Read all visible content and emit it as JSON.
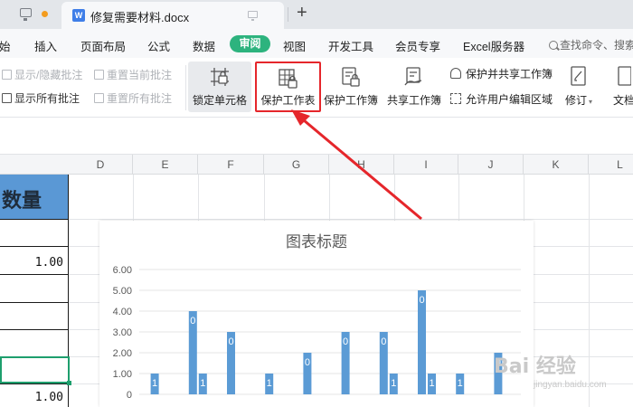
{
  "tabbar": {
    "doc_tab": {
      "icon_letter": "W",
      "title": "修复需要材料.docx"
    },
    "new_tab_glyph": "+"
  },
  "menu": {
    "items": [
      "始",
      "插入",
      "页面布局",
      "公式",
      "数据",
      "审阅",
      "视图",
      "开发工具",
      "会员专享",
      "Excel服务器"
    ],
    "active": "审阅",
    "search_text": "查找命令、搜索"
  },
  "ribbon": {
    "small_buttons": [
      {
        "label": "显示/隐藏批注",
        "enabled": false
      },
      {
        "label": "重置当前批注",
        "enabled": false
      },
      {
        "label": "显示所有批注",
        "enabled": true
      },
      {
        "label": "重置所有批注",
        "enabled": false
      }
    ],
    "big_buttons": [
      {
        "label": "锁定单元格",
        "state": "hover"
      },
      {
        "label": "保护工作表",
        "state": "highlighted"
      },
      {
        "label": "保护工作簿",
        "state": "normal"
      },
      {
        "label": "共享工作簿",
        "state": "normal"
      },
      {
        "label": "修订",
        "state": "normal"
      },
      {
        "label": "文档",
        "state": "normal"
      }
    ],
    "line_buttons": [
      {
        "label": "保护并共享工作簿"
      },
      {
        "label": "允许用户编辑区域"
      }
    ],
    "highlight_color": "#e5262b"
  },
  "sheet": {
    "columns": [
      "D",
      "E",
      "F",
      "G",
      "H",
      "I",
      "J",
      "K",
      "L"
    ],
    "cell_header": "数量",
    "cell_values": [
      {
        "row": 1,
        "value": "1.00"
      },
      {
        "row": 7,
        "value": "1.00"
      }
    ],
    "selection_color": "#1e9f6d",
    "header_fill": "#5a98d5"
  },
  "chart_data": {
    "type": "bar",
    "title": "图表标题",
    "xlabel": "",
    "ylabel": "",
    "ylim": [
      0,
      6
    ],
    "y_ticks": [
      "6.00",
      "5.00",
      "4.00",
      "3.00",
      "2.00",
      "1.00",
      "0"
    ],
    "series": [
      {
        "values": [
          1,
          4,
          3,
          1,
          2,
          3,
          3,
          5,
          1,
          2
        ]
      },
      {
        "values": [
          0,
          1,
          0,
          0,
          0,
          0,
          1,
          1,
          0,
          0
        ]
      }
    ],
    "bar_labels": [
      "1",
      "0",
      "0",
      "1",
      "0",
      "0",
      "0",
      "0",
      "1",
      "0"
    ],
    "bar_labels_2": [
      "",
      "1",
      "",
      "",
      "",
      "",
      "1",
      "1",
      "",
      ""
    ],
    "bar_color": "#5b9bd5",
    "grid": true,
    "legend": "none"
  },
  "watermark": {
    "text": "Bai 经验",
    "sub": "jingyan.baidu.com"
  }
}
